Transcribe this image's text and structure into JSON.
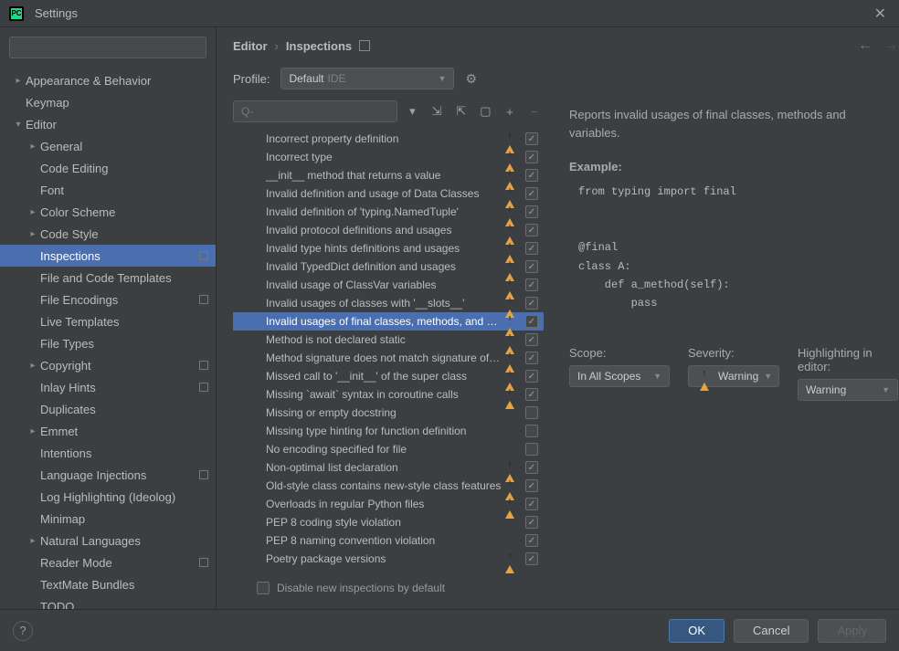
{
  "title": "Settings",
  "breadcrumb": {
    "root": "Editor",
    "leaf": "Inspections"
  },
  "profile": {
    "label": "Profile:",
    "value": "Default",
    "suffix": "IDE"
  },
  "sidebar_search_placeholder": "",
  "sidebar": [
    {
      "label": "Appearance & Behavior",
      "lvl": 0,
      "arrow": ">",
      "mark": false
    },
    {
      "label": "Keymap",
      "lvl": 0,
      "arrow": "",
      "mark": false,
      "pad": true
    },
    {
      "label": "Editor",
      "lvl": 0,
      "arrow": "v",
      "mark": false
    },
    {
      "label": "General",
      "lvl": 1,
      "arrow": ">",
      "mark": false
    },
    {
      "label": "Code Editing",
      "lvl": 1,
      "arrow": "",
      "mark": false,
      "pad": true
    },
    {
      "label": "Font",
      "lvl": 1,
      "arrow": "",
      "mark": false,
      "pad": true
    },
    {
      "label": "Color Scheme",
      "lvl": 1,
      "arrow": ">",
      "mark": false
    },
    {
      "label": "Code Style",
      "lvl": 1,
      "arrow": ">",
      "mark": false
    },
    {
      "label": "Inspections",
      "lvl": 1,
      "arrow": "",
      "mark": true,
      "sel": true,
      "pad": true
    },
    {
      "label": "File and Code Templates",
      "lvl": 1,
      "arrow": "",
      "mark": false,
      "pad": true
    },
    {
      "label": "File Encodings",
      "lvl": 1,
      "arrow": "",
      "mark": true,
      "pad": true
    },
    {
      "label": "Live Templates",
      "lvl": 1,
      "arrow": "",
      "mark": false,
      "pad": true
    },
    {
      "label": "File Types",
      "lvl": 1,
      "arrow": "",
      "mark": false,
      "pad": true
    },
    {
      "label": "Copyright",
      "lvl": 1,
      "arrow": ">",
      "mark": true
    },
    {
      "label": "Inlay Hints",
      "lvl": 1,
      "arrow": "",
      "mark": true,
      "pad": true
    },
    {
      "label": "Duplicates",
      "lvl": 1,
      "arrow": "",
      "mark": false,
      "pad": true
    },
    {
      "label": "Emmet",
      "lvl": 1,
      "arrow": ">",
      "mark": false
    },
    {
      "label": "Intentions",
      "lvl": 1,
      "arrow": "",
      "mark": false,
      "pad": true
    },
    {
      "label": "Language Injections",
      "lvl": 1,
      "arrow": "",
      "mark": true,
      "pad": true
    },
    {
      "label": "Log Highlighting (Ideolog)",
      "lvl": 1,
      "arrow": "",
      "mark": false,
      "pad": true
    },
    {
      "label": "Minimap",
      "lvl": 1,
      "arrow": "",
      "mark": false,
      "pad": true
    },
    {
      "label": "Natural Languages",
      "lvl": 1,
      "arrow": ">",
      "mark": false
    },
    {
      "label": "Reader Mode",
      "lvl": 1,
      "arrow": "",
      "mark": true,
      "pad": true
    },
    {
      "label": "TextMate Bundles",
      "lvl": 1,
      "arrow": "",
      "mark": false,
      "pad": true
    },
    {
      "label": "TODO",
      "lvl": 1,
      "arrow": "",
      "mark": false,
      "pad": true
    }
  ],
  "inspections": [
    {
      "label": "Incorrect property definition",
      "warn": true,
      "chk": true
    },
    {
      "label": "Incorrect type",
      "warn": true,
      "chk": true
    },
    {
      "label": "__init__ method that returns a value",
      "warn": true,
      "chk": true
    },
    {
      "label": "Invalid definition and usage of Data Classes",
      "warn": true,
      "chk": true
    },
    {
      "label": "Invalid definition of 'typing.NamedTuple'",
      "warn": true,
      "chk": true
    },
    {
      "label": "Invalid protocol definitions and usages",
      "warn": true,
      "chk": true
    },
    {
      "label": "Invalid type hints definitions and usages",
      "warn": true,
      "chk": true
    },
    {
      "label": "Invalid TypedDict definition and usages",
      "warn": true,
      "chk": true
    },
    {
      "label": "Invalid usage of ClassVar variables",
      "warn": true,
      "chk": true
    },
    {
      "label": "Invalid usages of classes with '__slots__'",
      "warn": true,
      "chk": true
    },
    {
      "label": "Invalid usages of final classes, methods, and variables",
      "warn": true,
      "chk": true,
      "sel": true
    },
    {
      "label": "Method is not declared static",
      "warn": true,
      "chk": true
    },
    {
      "label": "Method signature does not match signature of overridden method",
      "warn": true,
      "chk": true
    },
    {
      "label": "Missed call to '__init__' of the super class",
      "warn": true,
      "chk": true
    },
    {
      "label": "Missing `await` syntax in coroutine calls",
      "warn": true,
      "chk": true
    },
    {
      "label": "Missing or empty docstring",
      "warn": false,
      "chk": false
    },
    {
      "label": "Missing type hinting for function definition",
      "warn": false,
      "chk": false
    },
    {
      "label": "No encoding specified for file",
      "warn": false,
      "chk": false
    },
    {
      "label": "Non-optimal list declaration",
      "warn": true,
      "chk": true
    },
    {
      "label": "Old-style class contains new-style class features",
      "warn": true,
      "chk": true
    },
    {
      "label": "Overloads in regular Python files",
      "warn": true,
      "chk": true
    },
    {
      "label": "PEP 8 coding style violation",
      "warn": false,
      "chk": true
    },
    {
      "label": "PEP 8 naming convention violation",
      "warn": false,
      "chk": true
    },
    {
      "label": "Poetry package versions",
      "warn": true,
      "chk": true
    }
  ],
  "disable_label": "Disable new inspections by default",
  "description": "Reports invalid usages of final classes, methods and variables.",
  "example_label": "Example:",
  "code": "from typing import final\n\n\n@final\nclass A:\n    def a_method(self):\n        pass",
  "config": {
    "scope": {
      "label": "Scope:",
      "value": "In All Scopes"
    },
    "severity": {
      "label": "Severity:",
      "value": "Warning"
    },
    "highlight": {
      "label": "Highlighting in editor:",
      "value": "Warning"
    }
  },
  "footer": {
    "ok": "OK",
    "cancel": "Cancel",
    "apply": "Apply"
  }
}
